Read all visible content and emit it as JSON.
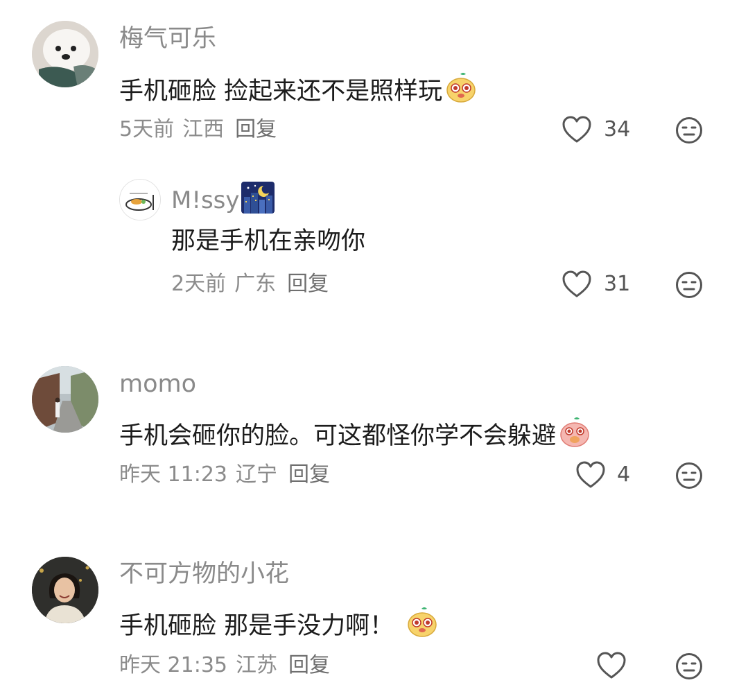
{
  "comments": [
    {
      "username": "梅气可乐",
      "text": "手机砸脸 捡起来还不是照样玩",
      "time": "5天前",
      "location": "江西",
      "reply_label": "回复",
      "likes": "34",
      "avatar_icon": "white-dog-avatar",
      "emoji_icon": "yellow-mascot-emoji",
      "replies": [
        {
          "username": "M!ssy",
          "text": "那是手机在亲吻你",
          "time": "2天前",
          "location": "广东",
          "reply_label": "回复",
          "likes": "31",
          "avatar_icon": "food-plate-avatar",
          "badge_icon": "night-city-emoji"
        }
      ]
    },
    {
      "username": "momo",
      "text": "手机会砸你的脸。可这都怪你学不会躲避",
      "time": "昨天 11:23",
      "location": "辽宁",
      "reply_label": "回复",
      "likes": "4",
      "avatar_icon": "street-avatar",
      "emoji_icon": "pink-mascot-emoji"
    },
    {
      "username": "不可方物的小花",
      "text": "手机砸脸 那是手没力啊！",
      "time": "昨天 21:35",
      "location": "江苏",
      "reply_label": "回复",
      "likes": "",
      "avatar_icon": "girl-portrait-avatar",
      "emoji_icon": "yellow-mascot-emoji"
    }
  ],
  "colors": {
    "text": "#1c1c1c",
    "secondary": "#8a8a8a",
    "icon": "#555555"
  }
}
